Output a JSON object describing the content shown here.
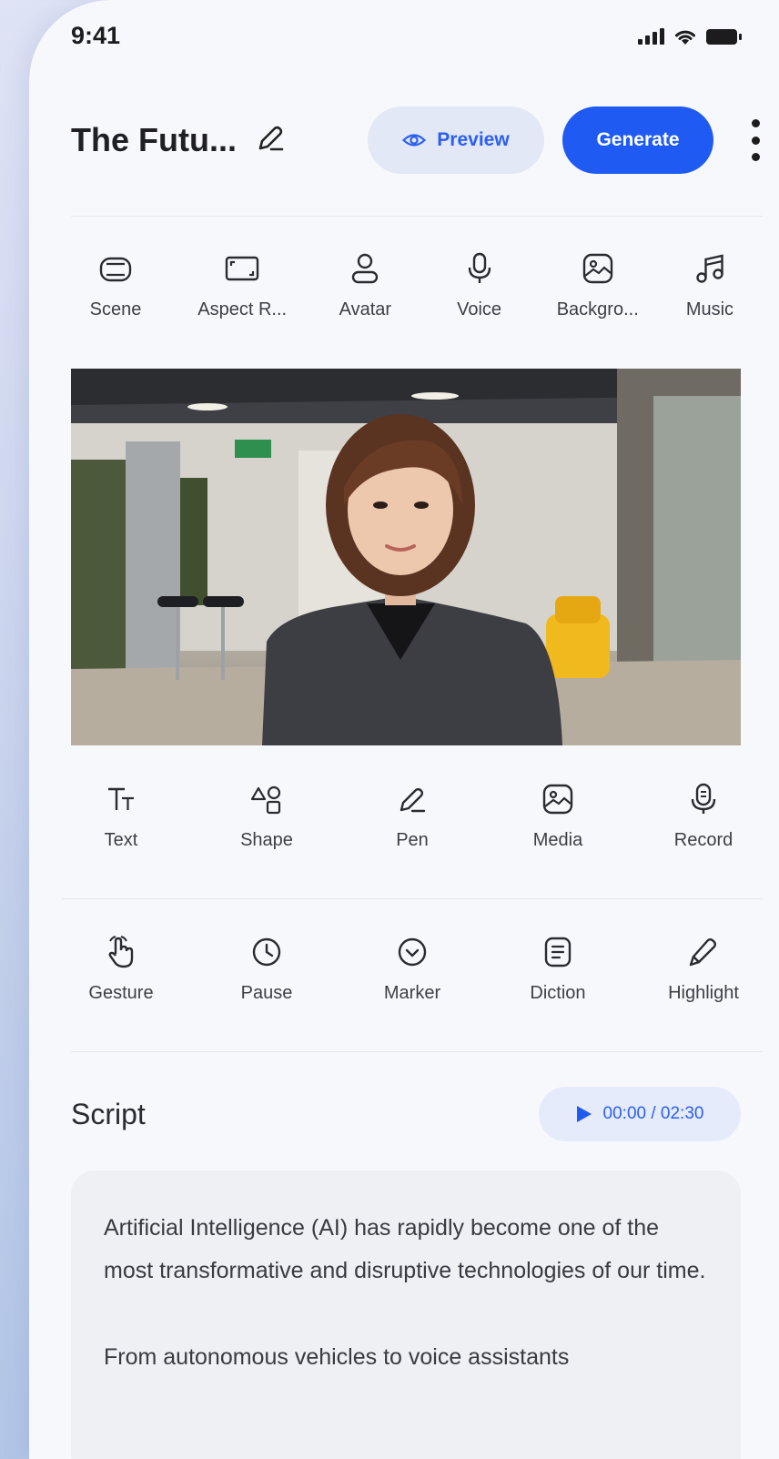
{
  "status": {
    "time": "9:41"
  },
  "header": {
    "title": "The Futu...",
    "preview_label": "Preview",
    "generate_label": "Generate"
  },
  "top_tools": [
    {
      "label": "Scene",
      "icon": "scene-icon"
    },
    {
      "label": "Aspect R...",
      "icon": "aspect-ratio-icon"
    },
    {
      "label": "Avatar",
      "icon": "avatar-icon"
    },
    {
      "label": "Voice",
      "icon": "microphone-icon"
    },
    {
      "label": "Backgro...",
      "icon": "image-icon"
    },
    {
      "label": "Music",
      "icon": "music-icon"
    }
  ],
  "edit_tools": [
    {
      "label": "Text",
      "icon": "text-icon"
    },
    {
      "label": "Shape",
      "icon": "shape-icon"
    },
    {
      "label": "Pen",
      "icon": "pen-icon"
    },
    {
      "label": "Media",
      "icon": "media-icon"
    },
    {
      "label": "Record",
      "icon": "record-icon"
    }
  ],
  "action_tools": [
    {
      "label": "Gesture",
      "icon": "gesture-icon"
    },
    {
      "label": "Pause",
      "icon": "clock-icon"
    },
    {
      "label": "Marker",
      "icon": "marker-icon"
    },
    {
      "label": "Diction",
      "icon": "document-icon"
    },
    {
      "label": "Highlight",
      "icon": "highlighter-icon"
    }
  ],
  "script": {
    "title": "Script",
    "timer": "00:00 / 02:30",
    "paragraphs": [
      "Artificial Intelligence (AI) has rapidly become one of the most transformative and disruptive technologies of our time.",
      "From autonomous vehicles to voice assistants"
    ]
  },
  "colors": {
    "accent": "#1f5bf2",
    "accent_soft": "#e3e8f7",
    "background": "#f7f8fb"
  }
}
